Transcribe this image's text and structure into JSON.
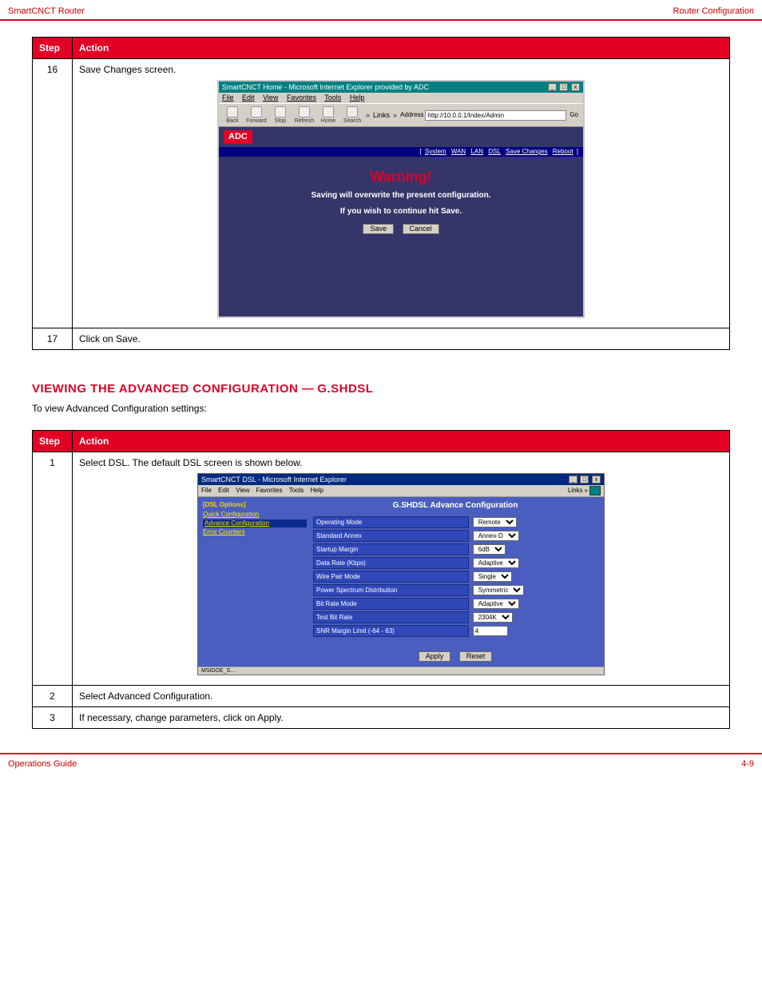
{
  "doc": {
    "header_left": "SmartCNCT Router",
    "header_right": "Router Configuration",
    "footer_left": "Operations Guide",
    "footer_right": "4-9"
  },
  "table1": {
    "head_step": "Step",
    "head_action": "Action",
    "step_no": "16",
    "caption": "Save Changes screen.",
    "final_step_no": "17",
    "final_action": "Click on Save."
  },
  "ieWarn": {
    "title": "SmartCNCT Home - Microsoft Internet Explorer provided by ADC",
    "menu": [
      "File",
      "Edit",
      "View",
      "Favorites",
      "Tools",
      "Help"
    ],
    "tb": {
      "back": "Back",
      "forward": "Forward",
      "stop": "Stop",
      "refresh": "Refresh",
      "home": "Home",
      "search": "Search"
    },
    "links_label": "Links",
    "address_label": "Address",
    "address_value": "http://10.0.0.1/Index/Admin",
    "go_label": "Go",
    "logo": "ADC",
    "nav": [
      "System",
      "WAN",
      "LAN",
      "DSL",
      "Save Changes",
      "Reboot"
    ],
    "warn_title": "Warning!",
    "warn_line1": "Saving will overwrite the present configuration.",
    "warn_line2": "If you wish to continue hit Save.",
    "btn_save": "Save",
    "btn_cancel": "Cancel"
  },
  "section": {
    "heading_prefix": "VIEWING THE ADVANCED CONFIGURATION",
    "heading_suffix": "G.SHDSL",
    "sub": "To view Advanced Configuration settings:"
  },
  "table2": {
    "head_step": "Step",
    "head_action": "Action",
    "step_no": "1",
    "caption": "Select DSL. The default DSL screen is shown below.",
    "row2_no": "2",
    "row2_action": "Select Advanced Configuration.",
    "row3_no": "3",
    "row3_action": "If necessary, change parameters, click on Apply."
  },
  "ieCfg": {
    "title": "SmartCNCT DSL - Microsoft Internet Explorer",
    "menu": [
      "File",
      "Edit",
      "View",
      "Favorites",
      "Tools",
      "Help"
    ],
    "links_label": "Links",
    "side_head": "[DSL Options]",
    "side_items": [
      "Quick Configuration",
      "Advance Configuration",
      "Error Counters"
    ],
    "main_title": "G.SHDSL Advance Configuration",
    "rows": [
      {
        "label": "Operating Mode",
        "type": "select",
        "value": "Remote"
      },
      {
        "label": "Standard Annex",
        "type": "select",
        "value": "Annex-D"
      },
      {
        "label": "Startup Margin",
        "type": "select",
        "value": "6dB"
      },
      {
        "label": "Data Rate (Kbps)",
        "type": "select",
        "value": "Adaptive"
      },
      {
        "label": "Wire Pair Mode",
        "type": "select",
        "value": "Single"
      },
      {
        "label": "Power Spectrum Distribution",
        "type": "select",
        "value": "Symmetric"
      },
      {
        "label": "Bit Rate Mode",
        "type": "select",
        "value": "Adaptive"
      },
      {
        "label": "Test Bit Rate",
        "type": "select",
        "value": "2304K"
      },
      {
        "label": "SNR Margin Limit (-64 - 63)",
        "type": "text",
        "value": "4"
      }
    ],
    "btn_apply": "Apply",
    "btn_reset": "Reset",
    "status": "MSIDOE_S..."
  }
}
